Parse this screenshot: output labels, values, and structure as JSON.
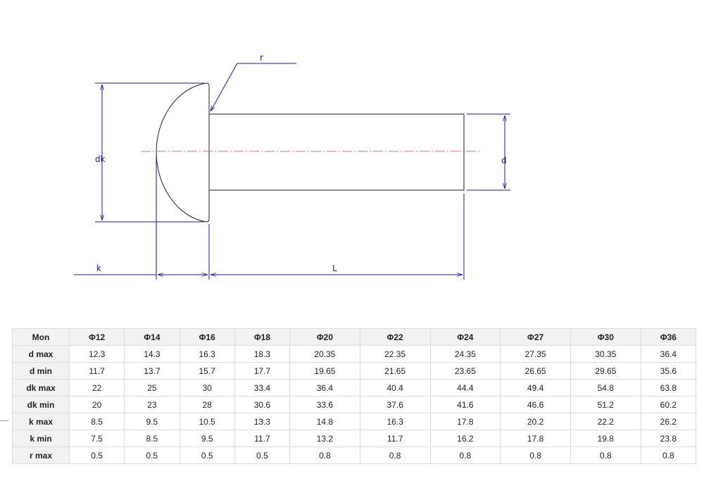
{
  "drawing": {
    "labels": {
      "r": "r",
      "dk": "dk",
      "d": "d",
      "k": "k",
      "L": "L"
    },
    "colors": {
      "dimension": "#1a1aa0",
      "centerline": "#e060c0",
      "outline": "#222222"
    }
  },
  "table": {
    "headers": [
      "Mon",
      "Φ12",
      "Φ14",
      "Φ16",
      "Φ18",
      "Φ20",
      "Φ22",
      "Φ24",
      "Φ27",
      "Φ30",
      "Φ36"
    ],
    "rows": [
      {
        "label": "d max",
        "values": [
          "12.3",
          "14.3",
          "16.3",
          "18.3",
          "20.35",
          "22.35",
          "24.35",
          "27.35",
          "30.35",
          "36.4"
        ]
      },
      {
        "label": "d min",
        "values": [
          "11.7",
          "13.7",
          "15.7",
          "17.7",
          "19.65",
          "21.65",
          "23.65",
          "26.65",
          "29.65",
          "35.6"
        ]
      },
      {
        "label": "dk max",
        "values": [
          "22",
          "25",
          "30",
          "33.4",
          "36.4",
          "40.4",
          "44.4",
          "49.4",
          "54.8",
          "63.8"
        ]
      },
      {
        "label": "dk min",
        "values": [
          "20",
          "23",
          "28",
          "30.6",
          "33.6",
          "37.6",
          "41.6",
          "46.6",
          "51.2",
          "60.2"
        ]
      },
      {
        "label": "k max",
        "values": [
          "8.5",
          "9.5",
          "10.5",
          "13.3",
          "14.8",
          "16.3",
          "17.8",
          "20.2",
          "22.2",
          "26.2"
        ]
      },
      {
        "label": "k min",
        "values": [
          "7.5",
          "8.5",
          "9.5",
          "11.7",
          "13.2",
          "11.7",
          "16.2",
          "17.8",
          "19.8",
          "23.8"
        ]
      },
      {
        "label": "r max",
        "values": [
          "0.5",
          "0.5",
          "0.5",
          "0.5",
          "0.8",
          "0.8",
          "0.8",
          "0.8",
          "0.8",
          "0.8"
        ]
      }
    ]
  }
}
